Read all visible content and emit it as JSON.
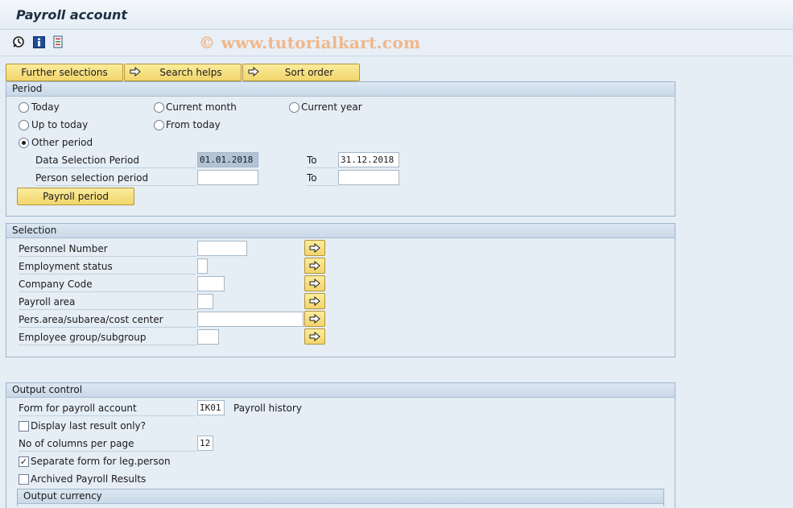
{
  "title": "Payroll account",
  "toolbar": {
    "icons": [
      "execute-clock-icon",
      "info-icon",
      "selection-options-icon"
    ]
  },
  "watermark": "© www.tutorialkart.com",
  "buttons": {
    "further_selections": "Further selections",
    "search_helps": "Search helps",
    "sort_order": "Sort order"
  },
  "period": {
    "header": "Period",
    "radios": {
      "today": "Today",
      "current_month": "Current month",
      "current_year": "Current year",
      "up_to_today": "Up to today",
      "from_today": "From today",
      "other_period": "Other period"
    },
    "selected": "other_period",
    "data_selection_label": "Data Selection Period",
    "data_selection_from": "01.01.2018",
    "data_selection_to_label": "To",
    "data_selection_to": "31.12.2018",
    "person_selection_label": "Person selection period",
    "person_selection_from": "",
    "person_selection_to_label": "To",
    "person_selection_to": "",
    "payroll_period_button": "Payroll period"
  },
  "selection": {
    "header": "Selection",
    "fields": [
      {
        "label": "Personnel Number",
        "value": ""
      },
      {
        "label": "Employment status",
        "value": ""
      },
      {
        "label": "Company Code",
        "value": ""
      },
      {
        "label": "Payroll area",
        "value": ""
      },
      {
        "label": "Pers.area/subarea/cost center",
        "value": ""
      },
      {
        "label": "Employee group/subgroup",
        "value": ""
      }
    ]
  },
  "output": {
    "header": "Output control",
    "form_label": "Form for payroll account",
    "form_value": "IK01",
    "form_desc": "Payroll history",
    "display_last_label": "Display last result only?",
    "display_last_checked": false,
    "columns_label": "No of columns per page",
    "columns_value": "12",
    "separate_form_label": "Separate form for leg.person",
    "separate_form_checked": true,
    "archived_label": "Archived Payroll Results",
    "archived_checked": false,
    "currency_header": "Output currency"
  },
  "colors": {
    "button_yellow": "#f2d56c",
    "background": "#e5edf5",
    "group_border": "#9fb4c9"
  }
}
